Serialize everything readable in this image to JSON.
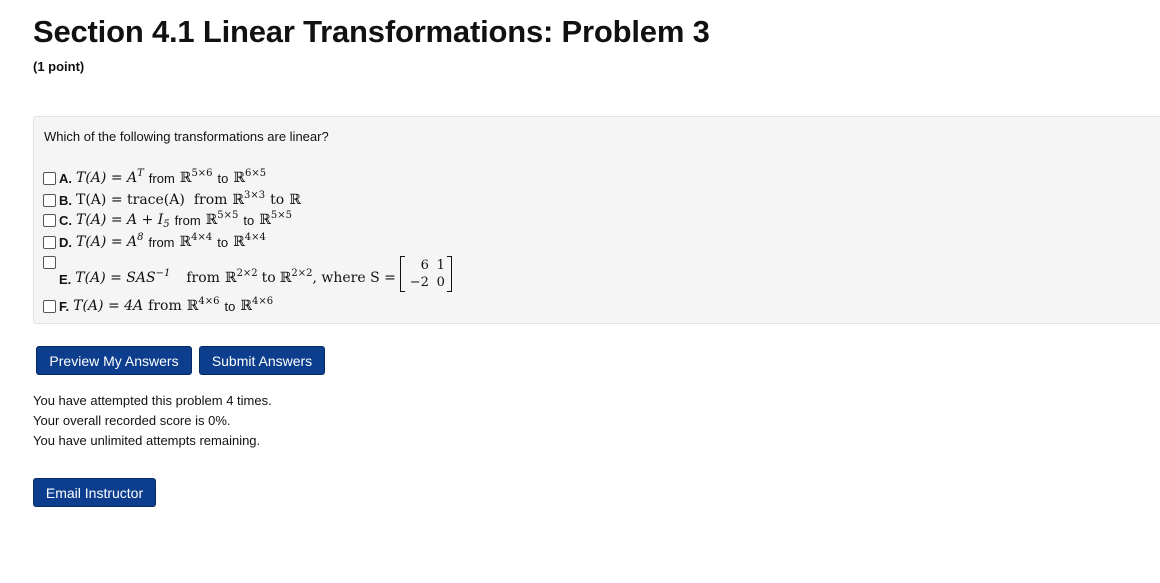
{
  "page": {
    "title": "Section 4.1 Linear Transformations: Problem 3",
    "points": "(1 point)"
  },
  "problem": {
    "question": "Which of the following transformations are linear?",
    "options": [
      {
        "label": "A.",
        "expr": "T(A) = A",
        "sup": "T",
        "from_word": "from",
        "from_space": "ℝ",
        "from_dim": "5×6",
        "to_word": "to",
        "to_space": "ℝ",
        "to_dim": "6×5"
      },
      {
        "label": "B.",
        "expr": "T(A) = trace(A)",
        "from_word": "from",
        "from_space": "ℝ",
        "from_dim": "3×3",
        "to_word": "to",
        "to_space": "ℝ"
      },
      {
        "label": "C.",
        "expr": "T(A) = A + I",
        "sub": "5",
        "from_word": "from",
        "from_space": "ℝ",
        "from_dim": "5×5",
        "to_word": "to",
        "to_space": "ℝ",
        "to_dim": "5×5"
      },
      {
        "label": "D.",
        "expr": "T(A) = A",
        "sup": "8",
        "from_word": "from",
        "from_space": "ℝ",
        "from_dim": "4×4",
        "to_word": "to",
        "to_space": "ℝ",
        "to_dim": "4×4"
      },
      {
        "label": "E.",
        "expr": "T(A) = SAS",
        "sup": "−1",
        "from_word": "from",
        "from_space": "ℝ",
        "from_dim": "2×2",
        "to_word": "to",
        "to_space": "ℝ",
        "to_dim": "2×2",
        "where": ", where S =",
        "matrix": [
          "6",
          "1",
          "−2",
          "0"
        ]
      },
      {
        "label": "F.",
        "expr": "T(A) = 4A",
        "from_word": "from",
        "from_space": "ℝ",
        "from_dim": "4×6",
        "to_word": "to",
        "to_space": "ℝ",
        "to_dim": "4×6"
      }
    ]
  },
  "buttons": {
    "preview": "Preview My Answers",
    "submit": "Submit Answers",
    "email": "Email Instructor"
  },
  "status": {
    "attempts": "You have attempted this problem 4 times.",
    "score": "Your overall recorded score is 0%.",
    "remaining": "You have unlimited attempts remaining."
  },
  "colors": {
    "button_bg": "#0d3e8e",
    "panel_bg": "#f5f5f5"
  }
}
